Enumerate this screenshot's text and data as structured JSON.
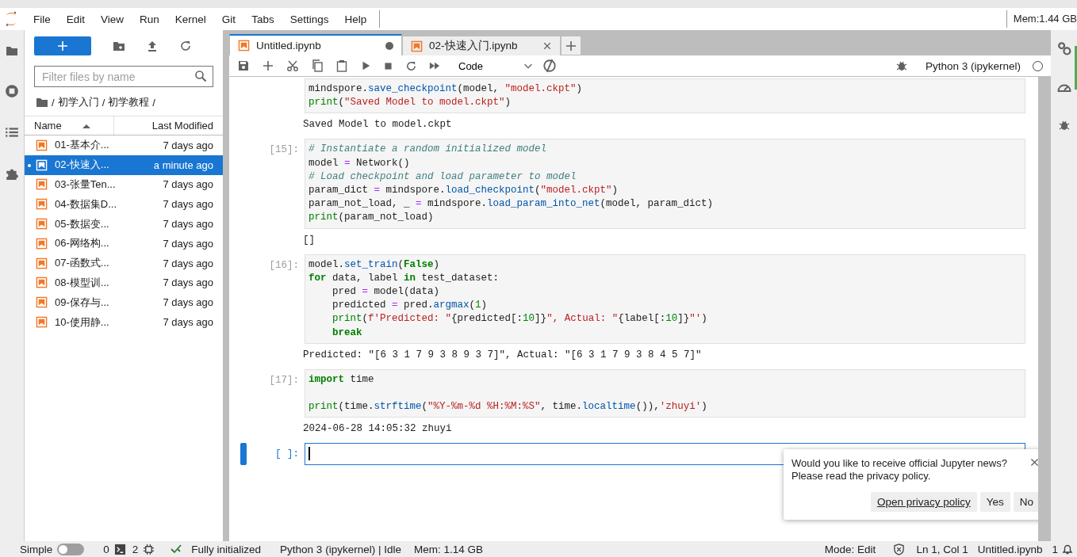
{
  "menu": [
    "File",
    "Edit",
    "View",
    "Run",
    "Kernel",
    "Git",
    "Tabs",
    "Settings",
    "Help"
  ],
  "memory_top": "Mem:1.44 GB",
  "file_browser": {
    "filter_placeholder": "Filter files by name",
    "breadcrumb": [
      "/",
      "初学入门",
      "/",
      "初学教程",
      "/"
    ],
    "columns": [
      "Name",
      "Last Modified"
    ],
    "files": [
      {
        "name": "01-基本介...",
        "modified": "7 days ago",
        "selected": false
      },
      {
        "name": "02-快速入...",
        "modified": "a minute ago",
        "selected": true
      },
      {
        "name": "03-张量Ten...",
        "modified": "7 days ago",
        "selected": false
      },
      {
        "name": "04-数据集D...",
        "modified": "7 days ago",
        "selected": false
      },
      {
        "name": "05-数据变...",
        "modified": "7 days ago",
        "selected": false
      },
      {
        "name": "06-网络构...",
        "modified": "7 days ago",
        "selected": false
      },
      {
        "name": "07-函数式...",
        "modified": "7 days ago",
        "selected": false
      },
      {
        "name": "08-模型训...",
        "modified": "7 days ago",
        "selected": false
      },
      {
        "name": "09-保存与...",
        "modified": "7 days ago",
        "selected": false
      },
      {
        "name": "10-使用静...",
        "modified": "7 days ago",
        "selected": false
      }
    ]
  },
  "tabs": [
    {
      "label": "Untitled.ipynb",
      "selected": true,
      "dirty": true
    },
    {
      "label": "02-快速入门.ipynb",
      "selected": false,
      "dirty": false
    }
  ],
  "toolbar": {
    "cell_type": "Code",
    "kernel": "Python 3 (ipykernel)",
    "kernel_busy": false
  },
  "cells": [
    {
      "active": false,
      "code": [
        {
          "kind": "plain",
          "text": "mindspore."
        },
        {
          "kind": "func",
          "text": "save_checkpoint"
        },
        {
          "kind": "plain",
          "text": "(model, "
        },
        {
          "kind": "str",
          "text": "\"model.ckpt\""
        },
        {
          "kind": "plain",
          "text": ")\n"
        },
        {
          "kind": "builtin",
          "text": "print"
        },
        {
          "kind": "plain",
          "text": "("
        },
        {
          "kind": "str",
          "text": "\"Saved Model to model.ckpt\""
        },
        {
          "kind": "plain",
          "text": ")"
        }
      ],
      "output": [
        "Saved Model to model.ckpt"
      ]
    },
    {
      "prompt": "[15]:",
      "active": false,
      "code": [
        {
          "kind": "comment",
          "text": "# Instantiate a random initialized model\n"
        },
        {
          "kind": "plain",
          "text": "model "
        },
        {
          "kind": "op",
          "text": "="
        },
        {
          "kind": "plain",
          "text": " Network()\n"
        },
        {
          "kind": "comment",
          "text": "# Load checkpoint and load parameter to model\n"
        },
        {
          "kind": "plain",
          "text": "param_dict "
        },
        {
          "kind": "op",
          "text": "="
        },
        {
          "kind": "plain",
          "text": " mindspore."
        },
        {
          "kind": "func",
          "text": "load_checkpoint"
        },
        {
          "kind": "plain",
          "text": "("
        },
        {
          "kind": "str",
          "text": "\"model.ckpt\""
        },
        {
          "kind": "plain",
          "text": ")\nparam_not_load, _ "
        },
        {
          "kind": "op",
          "text": "="
        },
        {
          "kind": "plain",
          "text": " mindspore."
        },
        {
          "kind": "func",
          "text": "load_param_into_net"
        },
        {
          "kind": "plain",
          "text": "(model, param_dict)\n"
        },
        {
          "kind": "builtin",
          "text": "print"
        },
        {
          "kind": "plain",
          "text": "(param_not_load)"
        }
      ],
      "output": [
        "[]"
      ]
    },
    {
      "prompt": "[16]:",
      "active": false,
      "code": [
        {
          "kind": "plain",
          "text": "model."
        },
        {
          "kind": "func",
          "text": "set_train"
        },
        {
          "kind": "plain",
          "text": "("
        },
        {
          "kind": "keyword",
          "text": "False"
        },
        {
          "kind": "plain",
          "text": ")\n"
        },
        {
          "kind": "keyword",
          "text": "for"
        },
        {
          "kind": "plain",
          "text": " data, label "
        },
        {
          "kind": "keyword",
          "text": "in"
        },
        {
          "kind": "plain",
          "text": " test_dataset:\n    pred "
        },
        {
          "kind": "op",
          "text": "="
        },
        {
          "kind": "plain",
          "text": " model(data)\n    predicted "
        },
        {
          "kind": "op",
          "text": "="
        },
        {
          "kind": "plain",
          "text": " pred."
        },
        {
          "kind": "func",
          "text": "argmax"
        },
        {
          "kind": "plain",
          "text": "("
        },
        {
          "kind": "num",
          "text": "1"
        },
        {
          "kind": "plain",
          "text": ")\n    "
        },
        {
          "kind": "builtin",
          "text": "print"
        },
        {
          "kind": "plain",
          "text": "("
        },
        {
          "kind": "str",
          "text": "f'Predicted: \""
        },
        {
          "kind": "plain",
          "text": "{predicted[:"
        },
        {
          "kind": "num",
          "text": "10"
        },
        {
          "kind": "plain",
          "text": "]}"
        },
        {
          "kind": "str",
          "text": "\", Actual: \""
        },
        {
          "kind": "plain",
          "text": "{label[:"
        },
        {
          "kind": "num",
          "text": "10"
        },
        {
          "kind": "plain",
          "text": "]}"
        },
        {
          "kind": "str",
          "text": "\"'"
        },
        {
          "kind": "plain",
          "text": ")\n    "
        },
        {
          "kind": "keyword",
          "text": "break"
        }
      ],
      "output": [
        "Predicted: \"[6 3 1 7 9 3 8 9 3 7]\", Actual: \"[6 3 1 7 9 3 8 4 5 7]\""
      ]
    },
    {
      "prompt": "[17]:",
      "active": false,
      "code": [
        {
          "kind": "keyword",
          "text": "import"
        },
        {
          "kind": "plain",
          "text": " time\n\n"
        },
        {
          "kind": "builtin",
          "text": "print"
        },
        {
          "kind": "plain",
          "text": "(time."
        },
        {
          "kind": "func",
          "text": "strftime"
        },
        {
          "kind": "plain",
          "text": "("
        },
        {
          "kind": "str",
          "text": "\"%Y-%m-%d %H:%M:%S\""
        },
        {
          "kind": "plain",
          "text": ", time."
        },
        {
          "kind": "func",
          "text": "localtime"
        },
        {
          "kind": "plain",
          "text": "()),"
        },
        {
          "kind": "str",
          "text": "'zhuyi'"
        },
        {
          "kind": "plain",
          "text": ")"
        }
      ],
      "output": [
        "2024-06-28 14:05:32 zhuyi"
      ]
    },
    {
      "prompt": "[ ]:",
      "active": true
    }
  ],
  "toast": {
    "message": [
      "Would you like to receive official Jupyter news?",
      "Please read the privacy policy."
    ],
    "link": "Open privacy policy",
    "buttons": [
      "Yes",
      "No"
    ]
  },
  "status": {
    "simple_label": "Simple",
    "simple_on": false,
    "terminals": "0",
    "kernels": "2",
    "init": "Fully initialized",
    "kernel": "Python 3 (ipykernel) | Idle",
    "memory": "Mem: 1.14 GB",
    "mode": "Mode: Edit",
    "position": "Ln 1, Col 1",
    "file": "Untitled.ipynb",
    "notifications": "1"
  }
}
